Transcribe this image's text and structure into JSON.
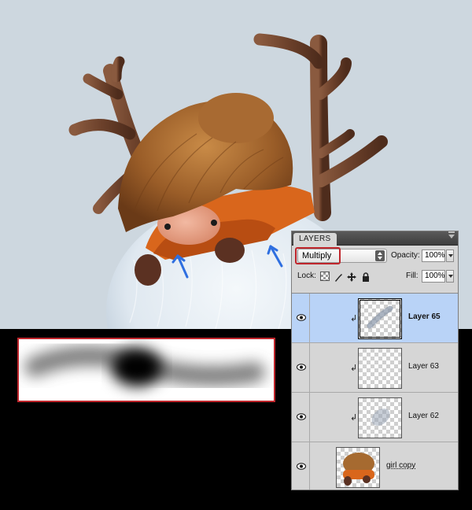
{
  "layers_panel": {
    "tab_label": "LAYERS",
    "blend_mode": "Multiply",
    "opacity_label": "Opacity:",
    "opacity_value": "100%",
    "lock_label": "Lock:",
    "fill_label": "Fill:",
    "fill_value": "100%",
    "layers": [
      {
        "name": "Layer 65",
        "selected": true,
        "clipped": true,
        "visible": true
      },
      {
        "name": "Layer 63",
        "selected": false,
        "clipped": true,
        "visible": true
      },
      {
        "name": "Layer 62",
        "selected": false,
        "clipped": true,
        "visible": true
      },
      {
        "name": "girl copy",
        "selected": false,
        "clipped": false,
        "visible": true
      }
    ]
  },
  "colors": {
    "canvas_background": "#cdd7df",
    "highlight_outline": "#c0262c",
    "selected_row": "#b9d3f7",
    "annotation_arrow": "#2f6fe0"
  },
  "icons": [
    "eye-icon",
    "transparency-lock-icon",
    "brush-lock-icon",
    "move-lock-icon",
    "padlock-icon",
    "panel-menu-icon",
    "clipping-arrow-icon"
  ]
}
